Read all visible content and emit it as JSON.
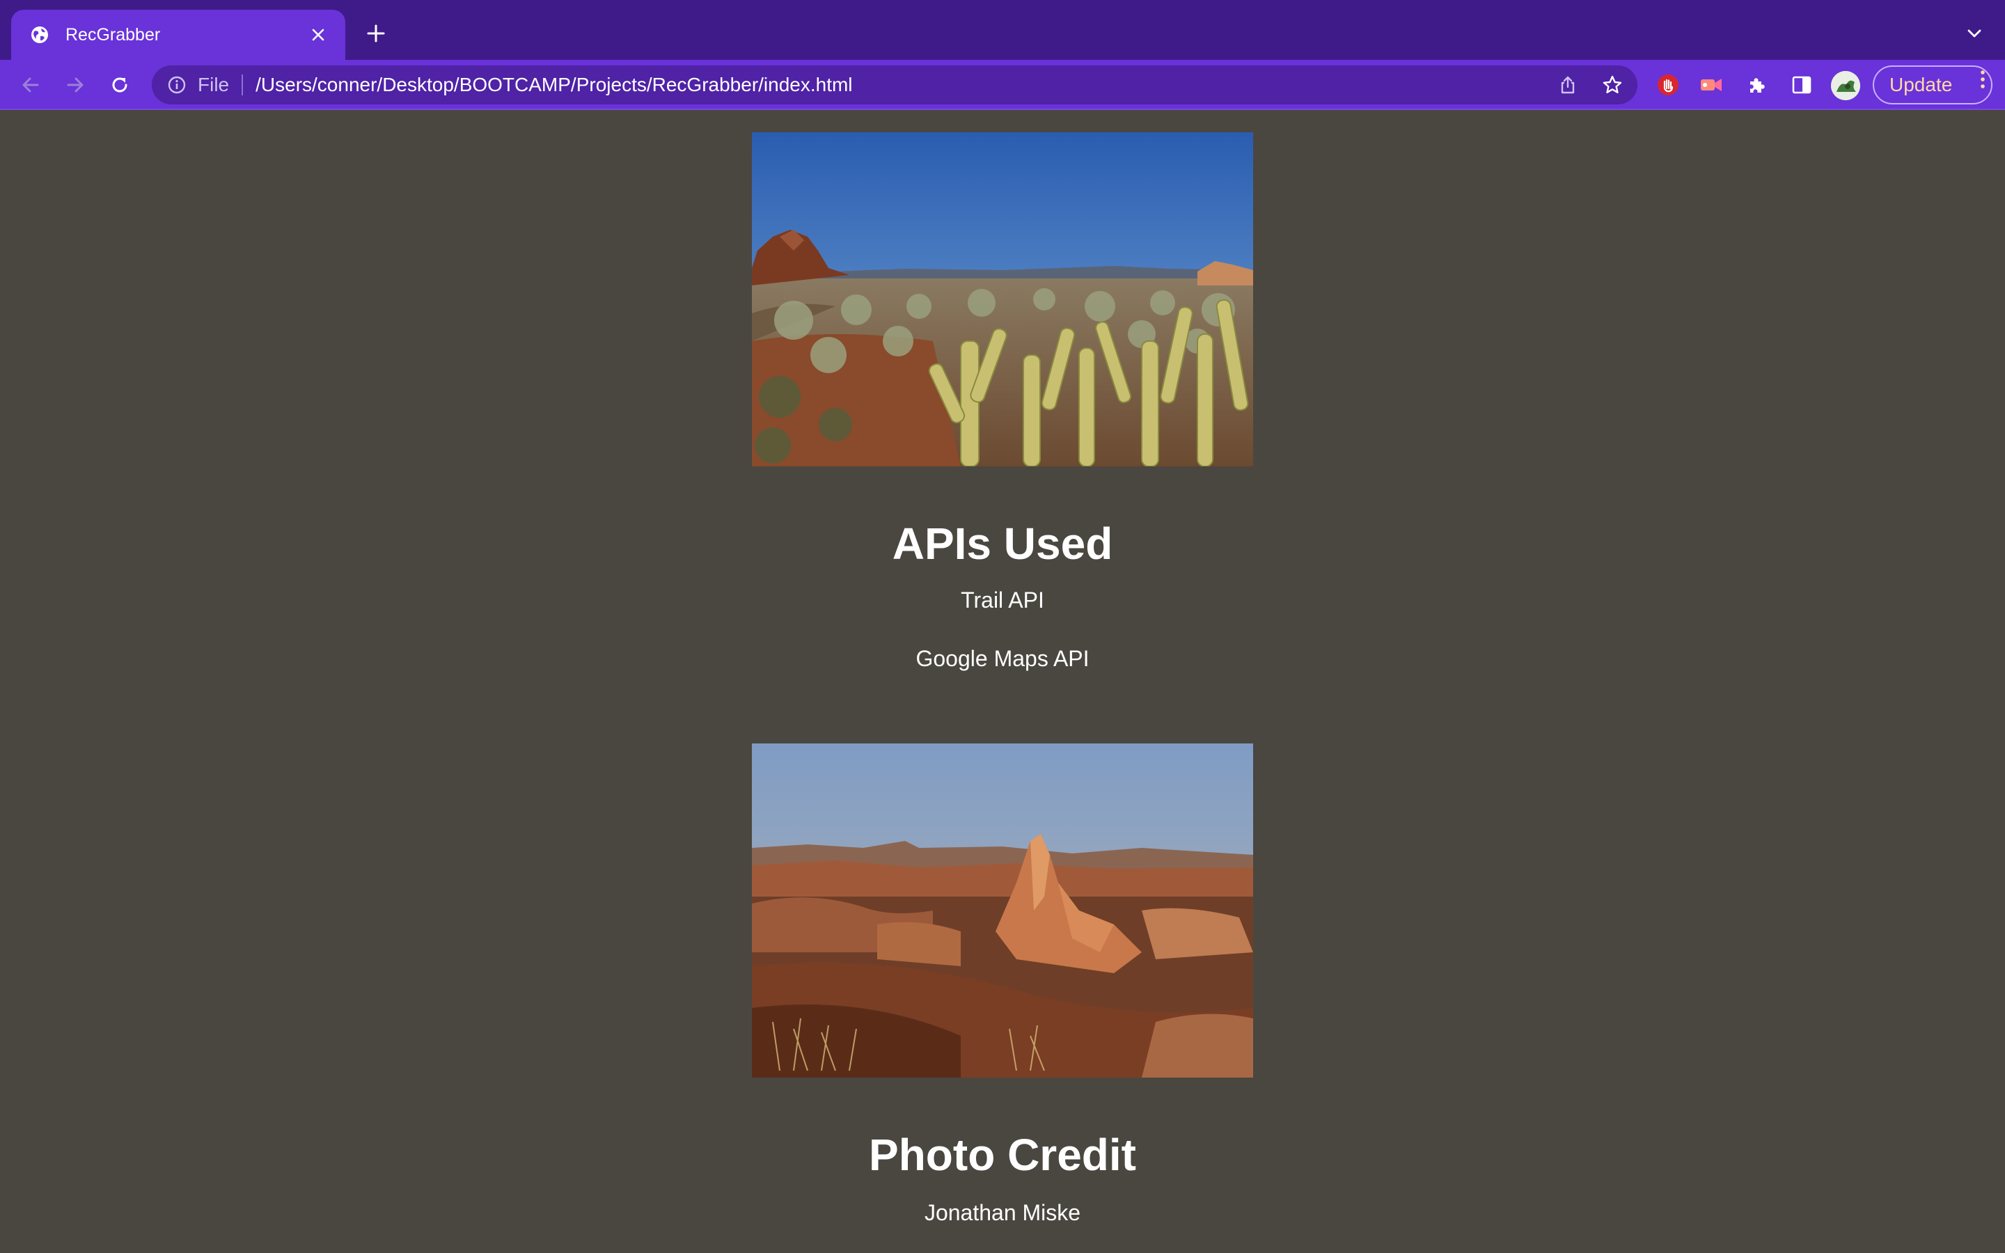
{
  "browser": {
    "tab": {
      "title": "RecGrabber"
    },
    "address_bar": {
      "scheme_label": "File",
      "url": "/Users/conner/Desktop/BOOTCAMP/Projects/RecGrabber/index.html"
    },
    "update_button": {
      "label": "Update"
    },
    "icons": [
      "globe-icon",
      "close-icon",
      "plus-icon",
      "chevron-down-icon",
      "back-arrow-icon",
      "forward-arrow-icon",
      "reload-icon",
      "info-icon",
      "share-icon",
      "star-icon",
      "hand-stop-extension-icon",
      "video-extension-icon",
      "puzzle-extensions-icon",
      "side-panel-icon",
      "kebab-menu-icon"
    ],
    "accent_colors": {
      "tab_strip": "#3f1b8a",
      "toolbar": "#6a32d9",
      "omnibox": "#4f22a6",
      "update_text": "#ffd8a8"
    }
  },
  "page": {
    "background": "#4a4740",
    "apis_section": {
      "title": "APIs Used",
      "items": [
        "Trail API",
        "Google Maps API"
      ]
    },
    "credit_section": {
      "title": "Photo Credit",
      "items": [
        "Jonathan Miske"
      ]
    }
  }
}
